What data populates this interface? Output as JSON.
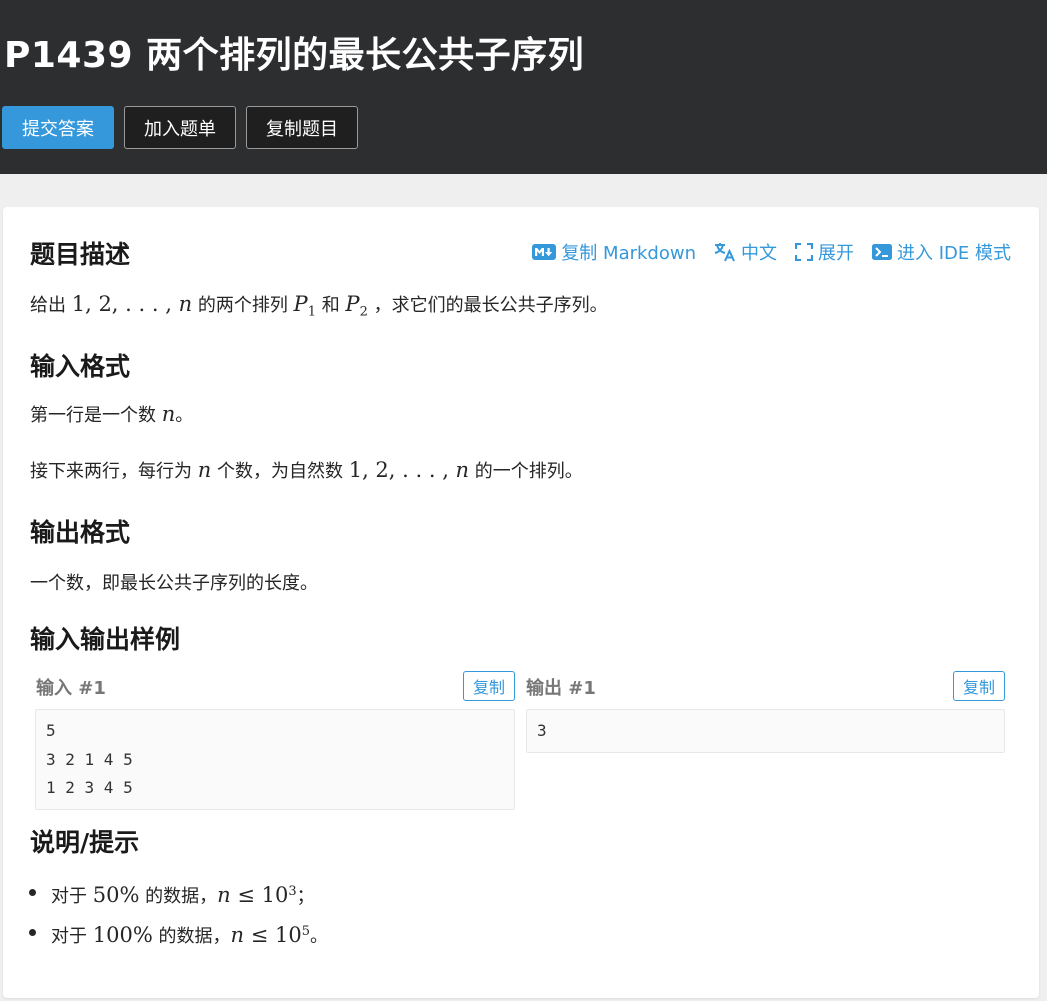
{
  "problem": {
    "title": "P1439 两个排列的最长公共子序列",
    "buttons": {
      "submit": "提交答案",
      "add_to_list": "加入题单",
      "copy_problem": "复制题目"
    }
  },
  "toolbar": {
    "copy_markdown": "复制 Markdown",
    "language": "中文",
    "expand": "展开",
    "ide_mode": "进入 IDE 模式"
  },
  "description": {
    "heading": "题目描述",
    "t1": "给出 ",
    "seq": "1, 2, . . . , ",
    "n": "n",
    "t2": " 的两个排列 ",
    "P": "P",
    "sub1": "1",
    "t3": " 和 ",
    "sub2": "2",
    "t4": " ，求它们的最长公共子序列。"
  },
  "input_format": {
    "heading": "输入格式",
    "l1a": "第一行是一个数 ",
    "l1b": "。",
    "l2a": "接下来两行，每行为 ",
    "l2b": " 个数，为自然数 ",
    "l2c": " 的一个排列。"
  },
  "output_format": {
    "heading": "输出格式",
    "text": "一个数，即最长公共子序列的长度。"
  },
  "samples": {
    "heading": "输入输出样例",
    "copy_label": "复制",
    "input_label": "输入 #1",
    "output_label": "输出 #1",
    "input": "5\n3 2 1 4 5\n1 2 3 4 5",
    "output": "3"
  },
  "hints": {
    "heading": "说明/提示",
    "h1a": "对于 ",
    "h1pct": "50%",
    "h1b": " 的数据，",
    "h1le": " ≤ 10",
    "h1exp": "3",
    "h1end": "；",
    "h2pct": "100%",
    "h2exp": "5",
    "h2end": "。"
  },
  "colors": {
    "header_bg": "#2d2e30",
    "accent": "#3498db",
    "page_bg": "#efefef"
  }
}
